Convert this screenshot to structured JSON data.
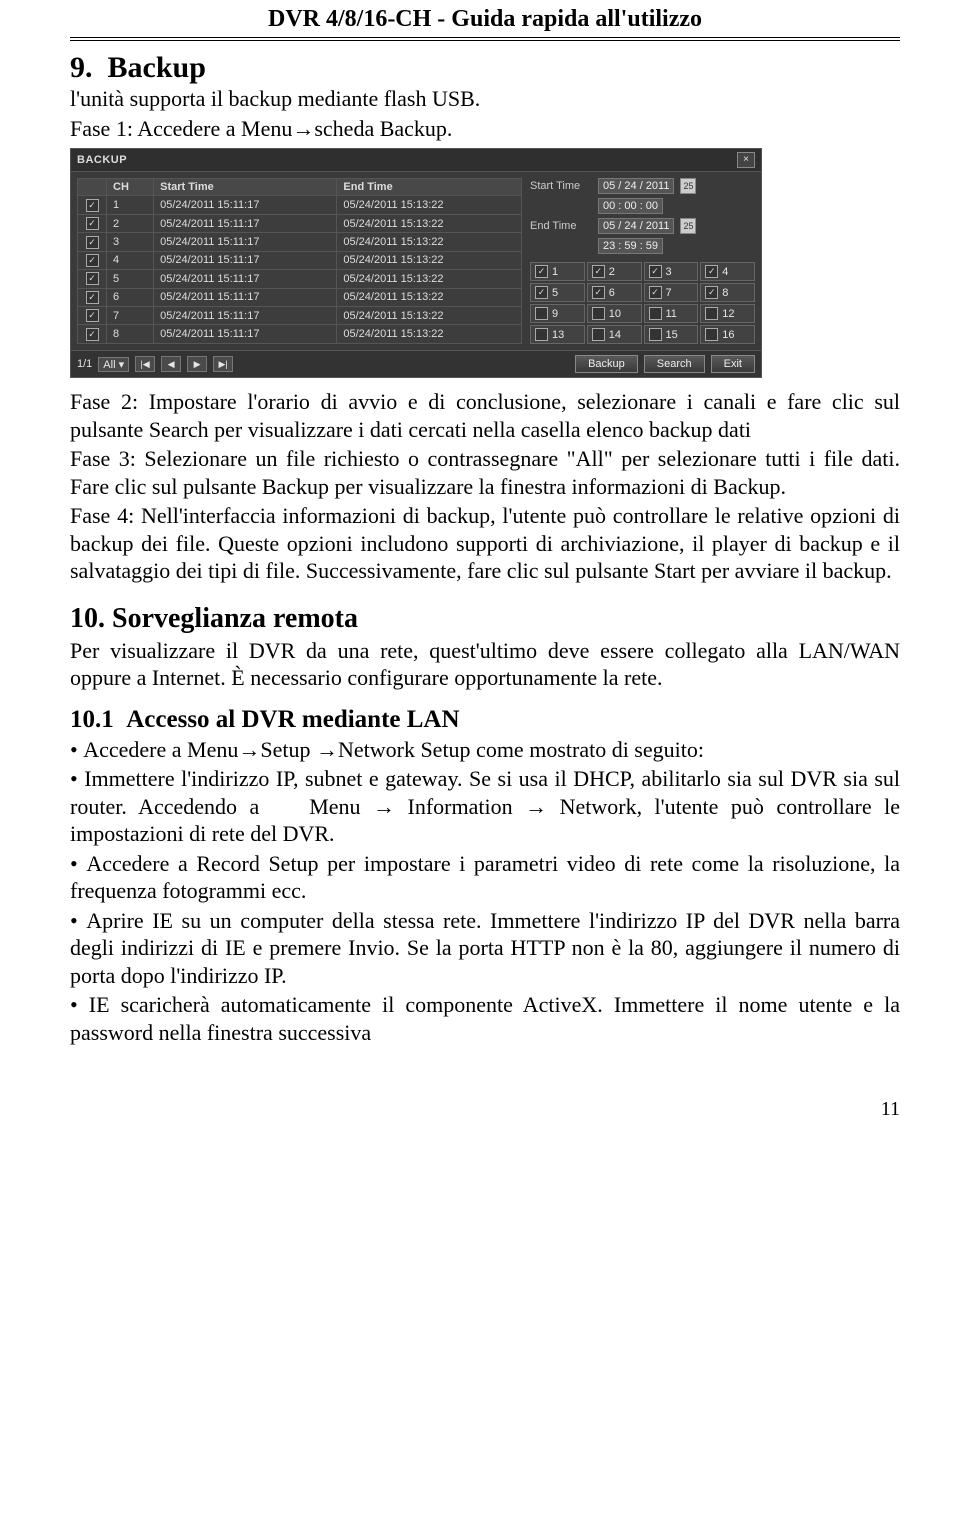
{
  "header": "DVR 4/8/16-CH - Guida rapida all'utilizzo",
  "s9_title": "9.  Backup",
  "s9_p1": "l'unità supporta il backup mediante flash USB.",
  "s9_p2_pre": "Fase 1: Accedere a Menu",
  "arrow": "→",
  "s9_p2_post": "scheda Backup.",
  "shot": {
    "title": "BACKUP",
    "close": "×",
    "cols": {
      "ch": "CH",
      "start": "Start Time",
      "end": "End Time"
    },
    "rows": [
      {
        "ch": "1",
        "s": "05/24/2011 15:11:17",
        "e": "05/24/2011 15:13:22"
      },
      {
        "ch": "2",
        "s": "05/24/2011 15:11:17",
        "e": "05/24/2011 15:13:22"
      },
      {
        "ch": "3",
        "s": "05/24/2011 15:11:17",
        "e": "05/24/2011 15:13:22"
      },
      {
        "ch": "4",
        "s": "05/24/2011 15:11:17",
        "e": "05/24/2011 15:13:22"
      },
      {
        "ch": "5",
        "s": "05/24/2011 15:11:17",
        "e": "05/24/2011 15:13:22"
      },
      {
        "ch": "6",
        "s": "05/24/2011 15:11:17",
        "e": "05/24/2011 15:13:22"
      },
      {
        "ch": "7",
        "s": "05/24/2011 15:11:17",
        "e": "05/24/2011 15:13:22"
      },
      {
        "ch": "8",
        "s": "05/24/2011 15:11:17",
        "e": "05/24/2011 15:13:22"
      }
    ],
    "side": {
      "startLabel": "Start Time",
      "startDate": "05 / 24 / 2011",
      "startTime": "00 : 00 : 00",
      "endLabel": "End Time",
      "endDate": "05 / 24 / 2011",
      "endTime": "23 : 59 : 59",
      "ch": [
        "1",
        "2",
        "3",
        "4",
        "5",
        "6",
        "7",
        "8",
        "9",
        "10",
        "11",
        "12",
        "13",
        "14",
        "15",
        "16"
      ],
      "checked": [
        true,
        true,
        true,
        true,
        true,
        true,
        true,
        true,
        false,
        false,
        false,
        false,
        false,
        false,
        false,
        false
      ]
    },
    "footer": {
      "page": "1/1",
      "all": "All",
      "first": "|◀",
      "prev": "◀",
      "next": "▶",
      "last": "▶|",
      "backup": "Backup",
      "search": "Search",
      "exit": "Exit"
    }
  },
  "s9_p3": "Fase 2: Impostare l'orario di avvio e di conclusione, selezionare i canali e fare clic sul pulsante Search per visualizzare i dati cercati nella casella elenco backup dati",
  "s9_p4": "Fase 3: Selezionare un file richiesto o contrassegnare \"All\" per selezionare tutti i file dati. Fare clic sul pulsante Backup per visualizzare la finestra informazioni di Backup.",
  "s9_p5": "Fase 4: Nell'interfaccia informazioni di backup, l'utente può controllare le relative opzioni di backup dei file. Queste opzioni includono supporti di archiviazione, il player di backup e il salvataggio dei tipi di file. Successivamente, fare clic sul pulsante Start per avviare il backup.",
  "s10_title": "10. Sorveglianza remota",
  "s10_p1": "Per visualizzare il DVR da una rete, quest'ultimo deve essere collegato alla LAN/WAN oppure a Internet. È necessario configurare opportunamente la rete.",
  "s10_1_title": "10.1  Accesso al DVR mediante LAN",
  "b1_pre": "Accedere a Menu",
  "b1_mid": "Setup ",
  "b1_post": "Network Setup come mostrato di seguito:",
  "b2_a": "Immettere l'indirizzo IP, subnet e gateway. Se si usa il DHCP, abilitarlo sia sul DVR sia sul router. Accedendo a    Menu ",
  "b2_b": " Information ",
  "b2_c": " Network, l'utente può controllare le impostazioni di rete del DVR.",
  "b3": "Accedere a Record Setup per impostare i parametri video di rete come la risoluzione, la frequenza fotogrammi ecc.",
  "b4": "Aprire IE su un computer della stessa rete. Immettere l'indirizzo IP del DVR nella barra degli indirizzi di IE e premere Invio. Se la porta HTTP non è la 80, aggiungere il numero di porta dopo l'indirizzo IP.",
  "b5": "IE scaricherà automaticamente il componente ActiveX. Immettere il nome utente e la password nella finestra successiva",
  "page_number": "11"
}
